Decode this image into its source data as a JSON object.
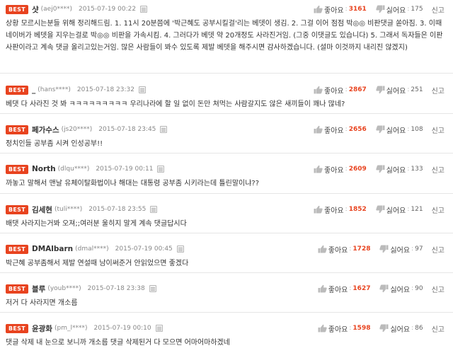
{
  "comments": [
    {
      "best": "BEST",
      "nick": "샷",
      "uid": "(aej0****)",
      "date": "2015-07-19 00:22",
      "body": "상황 모르시는분들 위해 정리해드림. 1. 11시 20분쯤에 '박근혜도 공부시킬걸'리는 베뎃이 생김. 2. 그걸 이어 점점 박◎◎ 비판댓글 쏟아짐. 3. 이때 네이버가 베뎃을 지우는걸로 박◎◎ 비판을 가속시킴. 4. 그러다가 베뎃 약 20개정도 사라진거임. (그중 이댓글도 있습니다) 5. 그래서 독자들은 이판사판이라고 계속 댓글 올리고있는거임. 많은 사람들이 봐수 있도록 제발 베뎃을 해주시면 감사하겠습니다. (설마 이것까지 내리진 않겠지)",
      "like_label": "좋아요",
      "likes": "3161",
      "dislike_label": "싫어요",
      "dislikes": "175",
      "report": "신고"
    },
    {
      "best": "BEST",
      "nick": "_",
      "uid": "(hans****)",
      "date": "2015-07-18 23:32",
      "body": "베댓 다 사라진 것 봐 ㅋㅋㅋㅋㅋㅋㅋㅋㅋ 우리나라에 할 일 없이 돈만 쳐먹는 사람갈지도 않은 새끼들이 꽤나 많네?",
      "like_label": "좋아요",
      "likes": "2867",
      "dislike_label": "싫어요",
      "dislikes": "251",
      "report": "신고"
    },
    {
      "best": "BEST",
      "nick": "페가수스",
      "uid": "(js20****)",
      "date": "2015-07-18 23:45",
      "body": "정치인들 공부좀 시켜 인성공부!!",
      "like_label": "좋아요",
      "likes": "2656",
      "dislike_label": "싫어요",
      "dislikes": "108",
      "report": "신고"
    },
    {
      "best": "BEST",
      "nick": "North",
      "uid": "(dlqu****)",
      "date": "2015-07-19 00:11",
      "body": "까놓고 말해서 맨날 유체이탈화법이나 해대는 대통령 공부좀 시키라는데 틀린말이냐??",
      "like_label": "좋아요",
      "likes": "2609",
      "dislike_label": "싫어요",
      "dislikes": "133",
      "report": "신고"
    },
    {
      "best": "BEST",
      "nick": "김세현",
      "uid": "(tuli****)",
      "date": "2015-07-18 23:55",
      "body": "배댓 사라지는거봐 오져;;여러분 울히지 말게 계속 댓글답시다",
      "like_label": "좋아요",
      "likes": "1852",
      "dislike_label": "싫어요",
      "dislikes": "121",
      "report": "신고"
    },
    {
      "best": "BEST",
      "nick": "DMAlbarn",
      "uid": "(dmal****)",
      "date": "2015-07-19 00:45",
      "body": "박근혜 공부좀해서 제발 연설때 남이써준거 안읽었으면 좋겠다",
      "like_label": "좋아요",
      "likes": "1728",
      "dislike_label": "싫어요",
      "dislikes": "97",
      "report": "신고"
    },
    {
      "best": "BEST",
      "nick": "블루",
      "uid": "(youb****)",
      "date": "2015-07-18 23:38",
      "body": "저거 다 사라지면 개소름",
      "like_label": "좋아요",
      "likes": "1627",
      "dislike_label": "싫어요",
      "dislikes": "90",
      "report": "신고"
    },
    {
      "best": "BEST",
      "nick": "윤광화",
      "uid": "(pm_l****)",
      "date": "2015-07-19 00:10",
      "body": "댓글 삭제 내 눈으로 보니까 개소름 댓글 삭제된거 다 모으면 어마어마하겠네",
      "like_label": "좋아요",
      "likes": "1598",
      "dislike_label": "싫어요",
      "dislikes": "86",
      "report": "신고"
    }
  ],
  "colors": {
    "best_badge": "#e8431f",
    "like_count": "#e8431f",
    "divider": "#e6e6e6"
  },
  "icons": {
    "flag": "report-flag-icon",
    "like": "thumbs-up-icon",
    "dislike": "thumbs-down-icon"
  }
}
